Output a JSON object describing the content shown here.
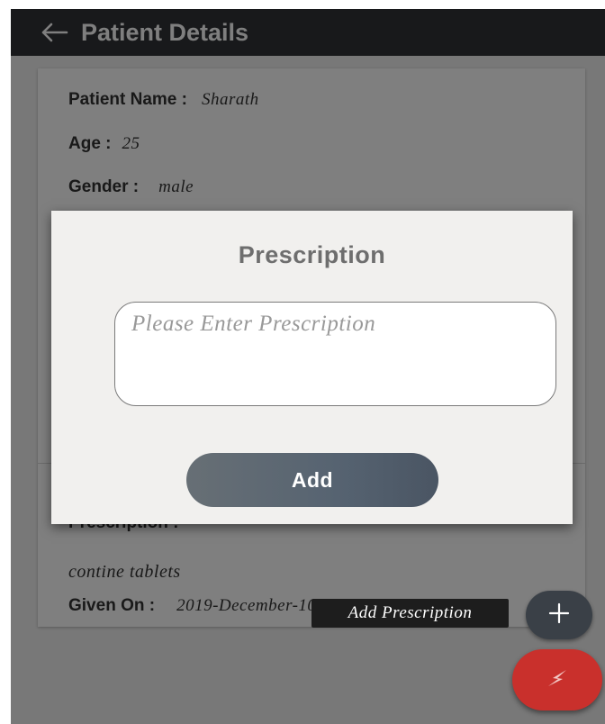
{
  "header": {
    "title": "Patient Details",
    "back_icon": "arrow-left-icon"
  },
  "patient": {
    "name_label": "Patient Name :",
    "name": "Sharath",
    "age_label": "Age :",
    "age": "25",
    "gender_label": "Gender :",
    "gender": "male"
  },
  "prescription_entry": {
    "label": "Prescription :",
    "text": "contine tablets",
    "given_on_label": "Given On :",
    "given_on": "2019-December-10"
  },
  "dialog": {
    "title": "Prescription",
    "input_value": "",
    "input_placeholder": "Please Enter Prescription",
    "add_label": "Add"
  },
  "fab": {
    "add_tooltip": "Add Prescription",
    "add_icon": "plus-icon",
    "main_icon": "lightning-icon"
  },
  "colors": {
    "appbar": "#303336",
    "fab_main": "#c9302c",
    "fab_add": "#3a4047",
    "add_button": "#566371"
  }
}
